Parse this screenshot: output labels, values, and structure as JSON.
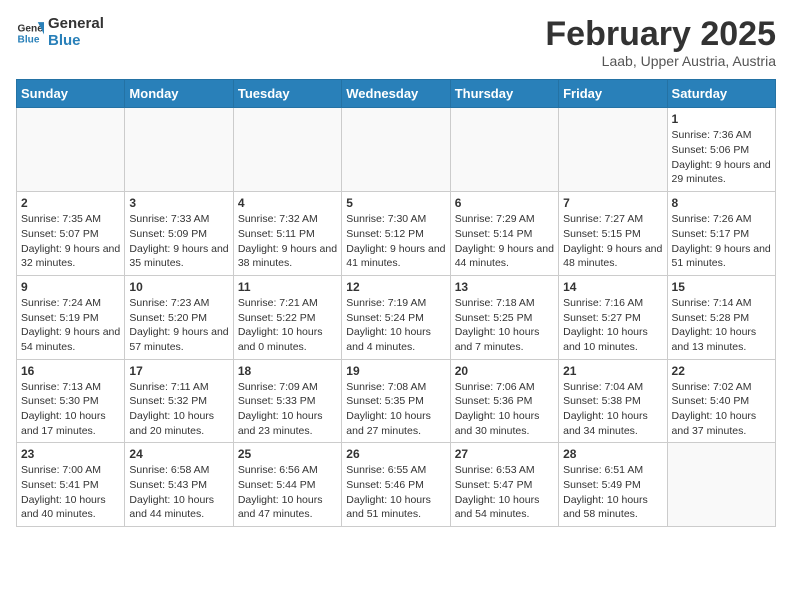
{
  "logo": {
    "general": "General",
    "blue": "Blue"
  },
  "title": "February 2025",
  "location": "Laab, Upper Austria, Austria",
  "weekdays": [
    "Sunday",
    "Monday",
    "Tuesday",
    "Wednesday",
    "Thursday",
    "Friday",
    "Saturday"
  ],
  "weeks": [
    [
      {
        "day": "",
        "info": ""
      },
      {
        "day": "",
        "info": ""
      },
      {
        "day": "",
        "info": ""
      },
      {
        "day": "",
        "info": ""
      },
      {
        "day": "",
        "info": ""
      },
      {
        "day": "",
        "info": ""
      },
      {
        "day": "1",
        "info": "Sunrise: 7:36 AM\nSunset: 5:06 PM\nDaylight: 9 hours and 29 minutes."
      }
    ],
    [
      {
        "day": "2",
        "info": "Sunrise: 7:35 AM\nSunset: 5:07 PM\nDaylight: 9 hours and 32 minutes."
      },
      {
        "day": "3",
        "info": "Sunrise: 7:33 AM\nSunset: 5:09 PM\nDaylight: 9 hours and 35 minutes."
      },
      {
        "day": "4",
        "info": "Sunrise: 7:32 AM\nSunset: 5:11 PM\nDaylight: 9 hours and 38 minutes."
      },
      {
        "day": "5",
        "info": "Sunrise: 7:30 AM\nSunset: 5:12 PM\nDaylight: 9 hours and 41 minutes."
      },
      {
        "day": "6",
        "info": "Sunrise: 7:29 AM\nSunset: 5:14 PM\nDaylight: 9 hours and 44 minutes."
      },
      {
        "day": "7",
        "info": "Sunrise: 7:27 AM\nSunset: 5:15 PM\nDaylight: 9 hours and 48 minutes."
      },
      {
        "day": "8",
        "info": "Sunrise: 7:26 AM\nSunset: 5:17 PM\nDaylight: 9 hours and 51 minutes."
      }
    ],
    [
      {
        "day": "9",
        "info": "Sunrise: 7:24 AM\nSunset: 5:19 PM\nDaylight: 9 hours and 54 minutes."
      },
      {
        "day": "10",
        "info": "Sunrise: 7:23 AM\nSunset: 5:20 PM\nDaylight: 9 hours and 57 minutes."
      },
      {
        "day": "11",
        "info": "Sunrise: 7:21 AM\nSunset: 5:22 PM\nDaylight: 10 hours and 0 minutes."
      },
      {
        "day": "12",
        "info": "Sunrise: 7:19 AM\nSunset: 5:24 PM\nDaylight: 10 hours and 4 minutes."
      },
      {
        "day": "13",
        "info": "Sunrise: 7:18 AM\nSunset: 5:25 PM\nDaylight: 10 hours and 7 minutes."
      },
      {
        "day": "14",
        "info": "Sunrise: 7:16 AM\nSunset: 5:27 PM\nDaylight: 10 hours and 10 minutes."
      },
      {
        "day": "15",
        "info": "Sunrise: 7:14 AM\nSunset: 5:28 PM\nDaylight: 10 hours and 13 minutes."
      }
    ],
    [
      {
        "day": "16",
        "info": "Sunrise: 7:13 AM\nSunset: 5:30 PM\nDaylight: 10 hours and 17 minutes."
      },
      {
        "day": "17",
        "info": "Sunrise: 7:11 AM\nSunset: 5:32 PM\nDaylight: 10 hours and 20 minutes."
      },
      {
        "day": "18",
        "info": "Sunrise: 7:09 AM\nSunset: 5:33 PM\nDaylight: 10 hours and 23 minutes."
      },
      {
        "day": "19",
        "info": "Sunrise: 7:08 AM\nSunset: 5:35 PM\nDaylight: 10 hours and 27 minutes."
      },
      {
        "day": "20",
        "info": "Sunrise: 7:06 AM\nSunset: 5:36 PM\nDaylight: 10 hours and 30 minutes."
      },
      {
        "day": "21",
        "info": "Sunrise: 7:04 AM\nSunset: 5:38 PM\nDaylight: 10 hours and 34 minutes."
      },
      {
        "day": "22",
        "info": "Sunrise: 7:02 AM\nSunset: 5:40 PM\nDaylight: 10 hours and 37 minutes."
      }
    ],
    [
      {
        "day": "23",
        "info": "Sunrise: 7:00 AM\nSunset: 5:41 PM\nDaylight: 10 hours and 40 minutes."
      },
      {
        "day": "24",
        "info": "Sunrise: 6:58 AM\nSunset: 5:43 PM\nDaylight: 10 hours and 44 minutes."
      },
      {
        "day": "25",
        "info": "Sunrise: 6:56 AM\nSunset: 5:44 PM\nDaylight: 10 hours and 47 minutes."
      },
      {
        "day": "26",
        "info": "Sunrise: 6:55 AM\nSunset: 5:46 PM\nDaylight: 10 hours and 51 minutes."
      },
      {
        "day": "27",
        "info": "Sunrise: 6:53 AM\nSunset: 5:47 PM\nDaylight: 10 hours and 54 minutes."
      },
      {
        "day": "28",
        "info": "Sunrise: 6:51 AM\nSunset: 5:49 PM\nDaylight: 10 hours and 58 minutes."
      },
      {
        "day": "",
        "info": ""
      }
    ]
  ]
}
